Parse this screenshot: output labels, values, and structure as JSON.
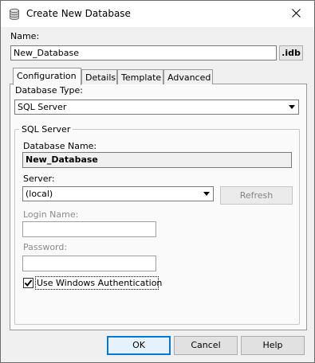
{
  "window": {
    "title": "Create New Database",
    "close_icon": "close-icon",
    "app_icon": "database-icon"
  },
  "name_field": {
    "label": "Name:",
    "value": "New_Database",
    "extension": ".idb"
  },
  "tabs": [
    {
      "label": "Configuration",
      "active": true
    },
    {
      "label": "Details",
      "active": false
    },
    {
      "label": "Template",
      "active": false
    },
    {
      "label": "Advanced",
      "active": false
    }
  ],
  "database_type": {
    "label": "Database Type:",
    "value": "SQL Server"
  },
  "sql_server_group": {
    "title": "SQL Server",
    "db_name_label": "Database Name:",
    "db_name_value": "New_Database",
    "server_label": "Server:",
    "server_value": "(local)",
    "refresh_label": "Refresh",
    "login_label": "Login Name:",
    "login_value": "",
    "password_label": "Password:",
    "password_value": "",
    "windows_auth_label": "Use Windows Authentication",
    "windows_auth_checked": true
  },
  "buttons": {
    "ok": "OK",
    "cancel": "Cancel",
    "help": "Help"
  }
}
